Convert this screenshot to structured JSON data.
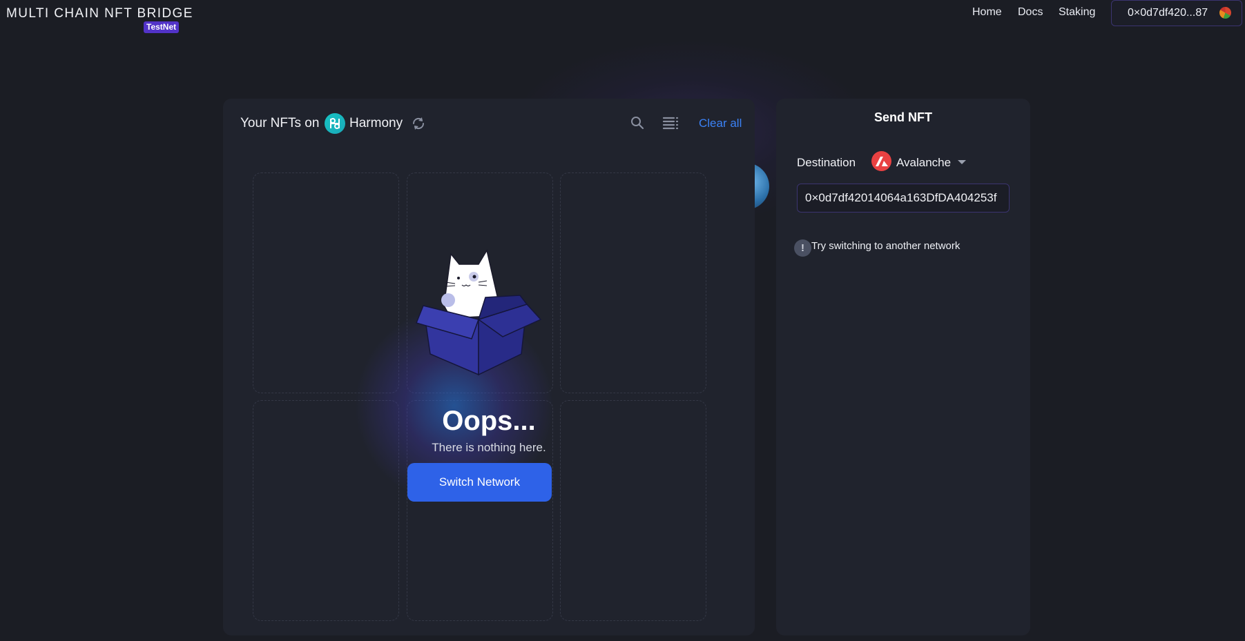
{
  "header": {
    "logo": "MULTI CHAIN NFT BRIDGE",
    "badge": "TestNet",
    "nav": {
      "home": "Home",
      "docs": "Docs",
      "staking": "Staking"
    },
    "wallet": {
      "address": "0×0d7df420...87",
      "avatar_icon": "wallet-avatar-icon"
    }
  },
  "nft_panel": {
    "title_prefix": "Your NFTs on",
    "network": "Harmony",
    "network_icon": "harmony-icon",
    "clear_all": "Clear all",
    "empty": {
      "heading": "Oops...",
      "message": "There is nothing here.",
      "button": "Switch Network"
    }
  },
  "send_panel": {
    "title": "Send NFT",
    "destination_label": "Destination",
    "destination_network": "Avalanche",
    "destination_icon": "avalanche-icon",
    "address_value": "0×0d7df42014064a163DfDA404253f",
    "warning": "Try switching to another network"
  },
  "colors": {
    "background": "#1b1d24",
    "panel": "#20232d",
    "accent_blue": "#2e62e8",
    "link_blue": "#3b82f6",
    "badge_purple": "#5233c8",
    "avalanche_red": "#e84142",
    "harmony_teal": "#17c3c3"
  }
}
